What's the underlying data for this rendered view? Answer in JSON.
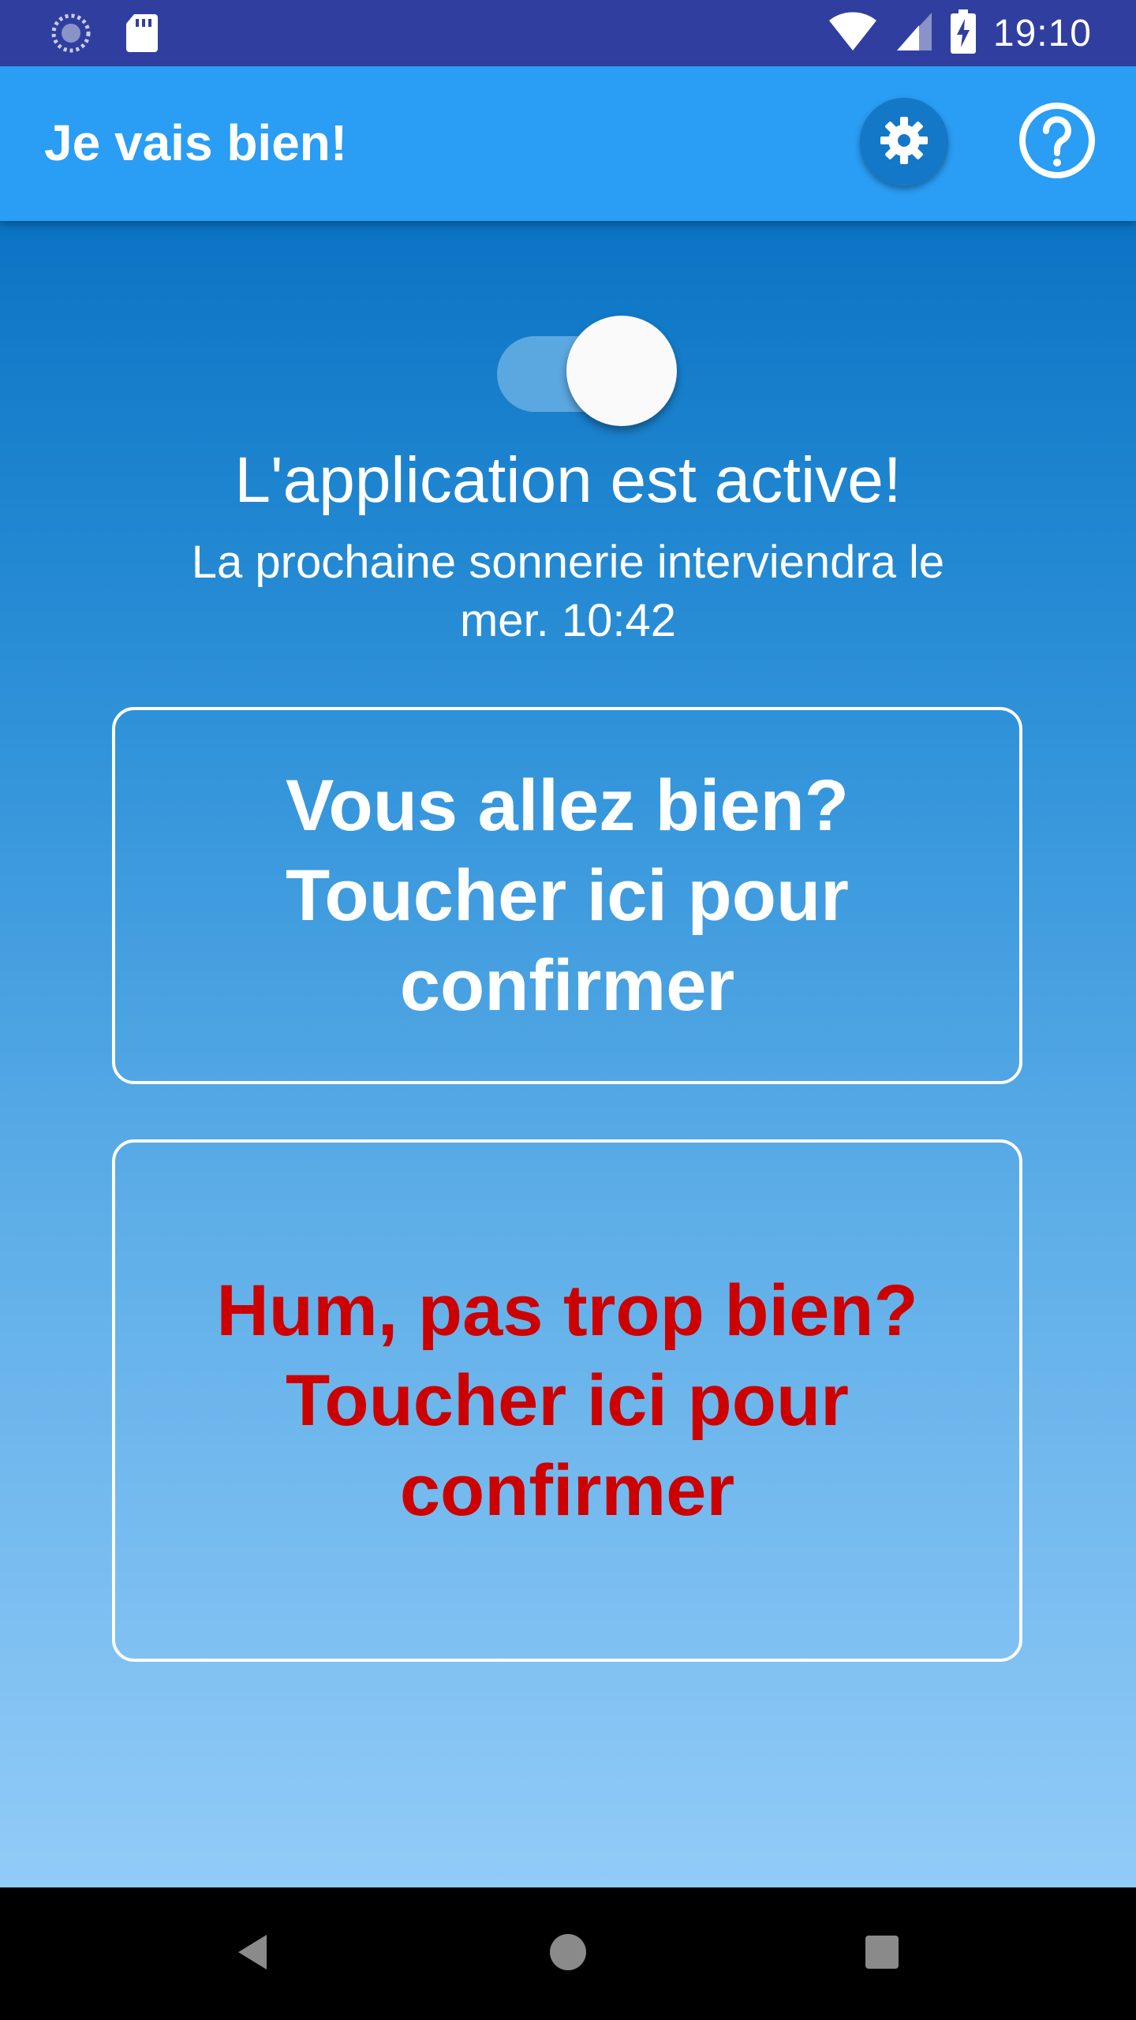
{
  "status_bar": {
    "time": "19:10",
    "icons": [
      "sync-icon",
      "sd-card-icon",
      "wifi-icon",
      "signal-icon",
      "battery-charging-icon"
    ]
  },
  "app_bar": {
    "title": "Je vais bien!",
    "actions": [
      "settings-icon",
      "help-icon"
    ]
  },
  "main": {
    "toggle": {
      "state": "on"
    },
    "status_title": "L'application est active!",
    "next_ring_text": "La prochaine sonnerie interviendra le mer. 10:42",
    "ok_card": {
      "line1": "Vous allez bien?",
      "line2": "Toucher ici pour confirmer"
    },
    "not_ok_card": {
      "line1": "Hum, pas trop bien?",
      "line2": "Toucher ici pour confirmer"
    }
  },
  "nav_bar": {
    "buttons": [
      "back-icon",
      "home-icon",
      "recents-icon"
    ]
  },
  "colors": {
    "status_bar": "#303F9F",
    "app_bar": "#2A9DF4",
    "gradient_top": "#0A74C4",
    "gradient_bottom": "#92CBF8",
    "alert_text": "#CC0000"
  }
}
